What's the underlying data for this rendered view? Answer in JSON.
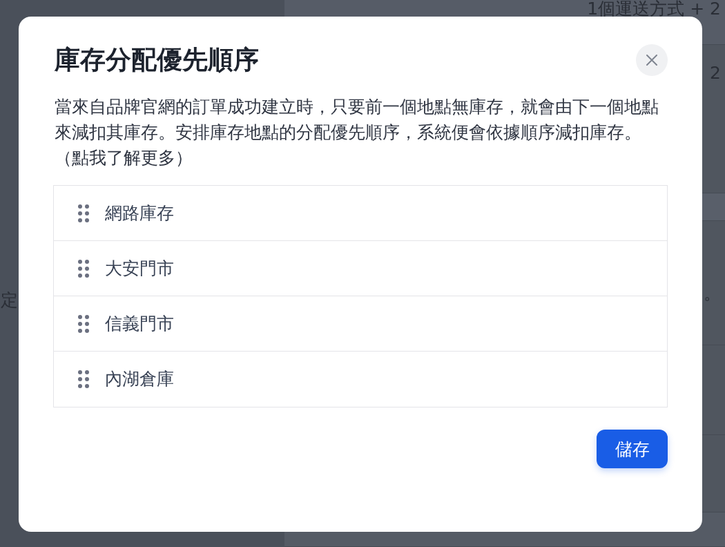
{
  "background_page": {
    "side_text": "定",
    "header_row": {
      "shipping_summary": "1個運送方式 + 2"
    },
    "second_row": {
      "value": "2"
    },
    "body_row": {
      "text": "。"
    }
  },
  "dialog": {
    "title": "庫存分配優先順序",
    "description": "當來自品牌官網的訂單成功建立時，只要前一個地點無庫存，就會由下一個地點來減扣其庫存。安排庫存地點的分配優先順序，系統便會依據順序減扣庫存。",
    "learn_more_link": "（點我了解更多）",
    "locations": [
      {
        "name": "網路庫存"
      },
      {
        "name": "大安門市"
      },
      {
        "name": "信義門市"
      },
      {
        "name": "內湖倉庫"
      }
    ],
    "save_button": "儲存"
  }
}
